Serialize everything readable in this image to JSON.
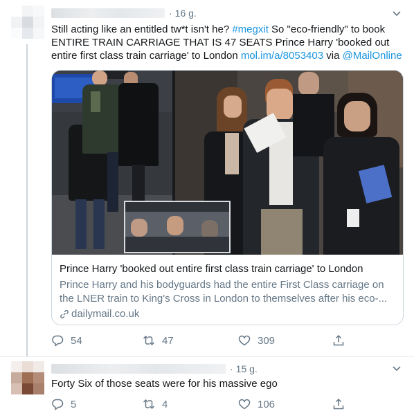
{
  "tweets": [
    {
      "time": "16 g.",
      "text_plain": "Still acting like an entitled tw*t isn't he? ",
      "hashtag": "#megxit",
      "text_mid": " So \"eco-friendly\" to book ENTIRE TRAIN CARRIAGE THAT IS 47 SEATS Prince Harry 'booked out entire first class train carriage' to London ",
      "url": "mol.im/a/8053403",
      "via": " via ",
      "mention": "@MailOnline",
      "card": {
        "title": "Prince Harry 'booked out entire first class train carriage' to London",
        "description": "Prince Harry and his bodyguards had the entire First Class carriage on the LNER train to King's Cross in London to themselves after his eco-...",
        "domain": "dailymail.co.uk"
      },
      "actions": {
        "replies": "54",
        "retweets": "47",
        "likes": "309"
      }
    },
    {
      "time": "15 g.",
      "text": "Forty Six of those seats were for his massive ego",
      "actions": {
        "replies": "5",
        "retweets": "4",
        "likes": "106"
      }
    }
  ],
  "colors": {
    "link": "#1b95e0",
    "secondary_text": "#657786",
    "border": "#ccd6dd"
  },
  "icons": [
    "caret-down-icon",
    "reply-icon",
    "retweet-icon",
    "like-icon",
    "share-icon",
    "link-icon"
  ]
}
